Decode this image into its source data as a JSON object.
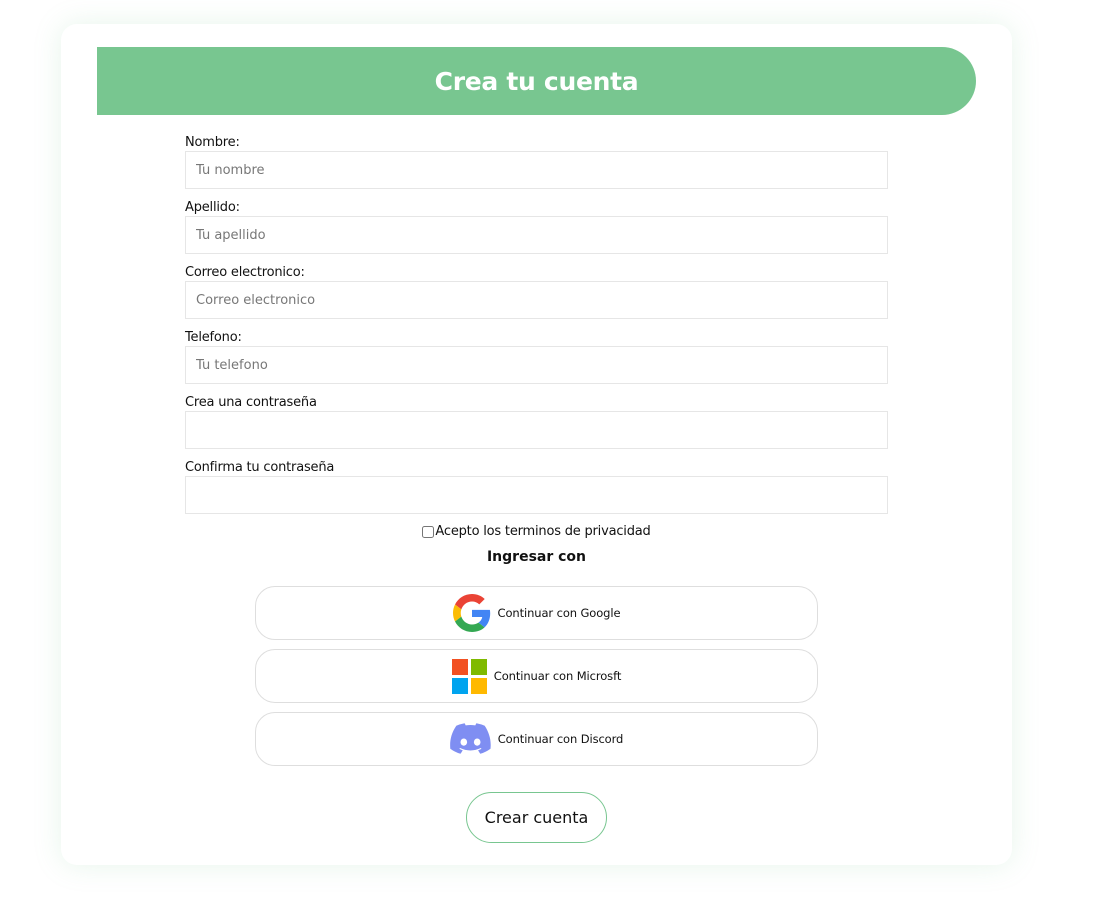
{
  "form": {
    "title": "Crea tu cuenta",
    "fields": [
      {
        "label": "Nombre:",
        "placeholder": "Tu nombre",
        "value": ""
      },
      {
        "label": "Apellido:",
        "placeholder": "Tu apellido",
        "value": ""
      },
      {
        "label": "Correo electronico:",
        "placeholder": "Correo electronico",
        "value": ""
      },
      {
        "label": "Telefono:",
        "placeholder": "Tu telefono",
        "value": ""
      },
      {
        "label": "Crea una contraseña",
        "placeholder": "",
        "value": ""
      },
      {
        "label": "Confirma tu contraseña",
        "placeholder": "",
        "value": ""
      }
    ],
    "terms_label": "Acepto los terminos de privacidad",
    "terms_checked": false,
    "social_heading": "Ingresar con",
    "social_buttons": [
      {
        "label": "Continuar con Google",
        "icon": "google-icon"
      },
      {
        "label": "Continuar con Microsft",
        "icon": "microsoft-icon"
      },
      {
        "label": "Continuar con Discord",
        "icon": "discord-icon"
      }
    ],
    "submit_label": "Crear cuenta"
  },
  "colors": {
    "accent": "#78c690",
    "google_red": "#ea4335",
    "google_yellow": "#fbbc05",
    "google_green": "#34a853",
    "google_blue": "#4285f4",
    "microsoft_red": "#f25022",
    "microsoft_green": "#7fba00",
    "microsoft_blue": "#00a4ef",
    "microsoft_yellow": "#ffb900",
    "discord": "#7289da"
  }
}
